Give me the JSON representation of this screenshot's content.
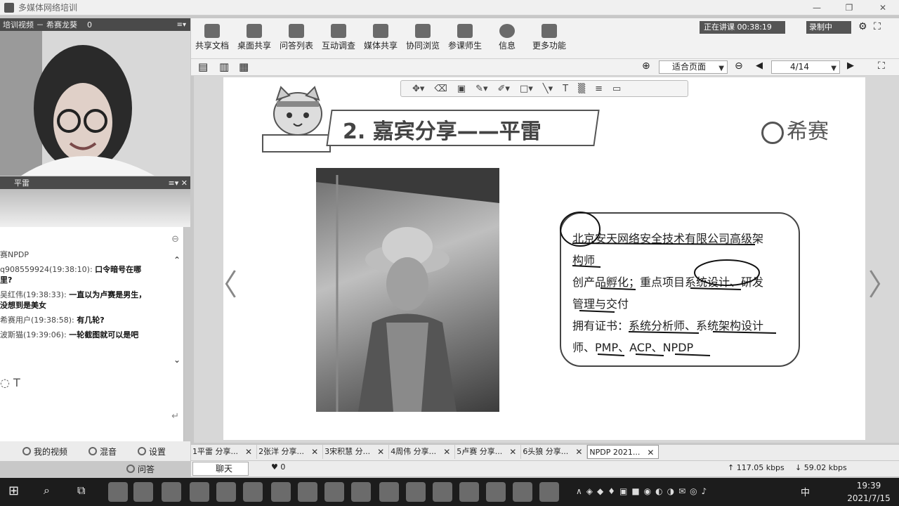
{
  "window": {
    "title": "多媒体网络培训"
  },
  "video_panel": {
    "title": "培训视频 － 希赛龙葵",
    "count": "0"
  },
  "participant_panel": {
    "name": "平雷"
  },
  "chat": {
    "lines": [
      {
        "who": "赛NPDP",
        "msg": ""
      },
      {
        "who": "q908559924(19:38:10):",
        "msg": "口令暗号在哪"
      },
      {
        "who": "",
        "msg": "里?"
      },
      {
        "who": "吴红伟(19:38:33):",
        "msg": "一直以为卢赛是男生，"
      },
      {
        "who": "",
        "msg": "没想到是美女"
      },
      {
        "who": "希赛用户(19:38:58):",
        "msg": "有几轮?"
      },
      {
        "who": "波斯猫(19:39:06):",
        "msg": "一轮截图就可以是吧"
      }
    ]
  },
  "left_bottom": {
    "my_video": "我的视频",
    "mix": "混音",
    "settings": "设置",
    "qa": "问答"
  },
  "toolbar": {
    "buttons": [
      "共享文档",
      "桌面共享",
      "问答列表",
      "互动调查",
      "媒体共享",
      "协同浏览",
      "参课师生",
      "信息",
      "更多功能"
    ],
    "status_left": "正在讲课 00:38:19",
    "status_right": "录制中"
  },
  "nav": {
    "zoom": "适合页面",
    "page": "4/14"
  },
  "slide": {
    "title": "2. 嘉宾分享——平雷",
    "brand": "希赛",
    "info_lines": [
      "北京安天网络安全技术有限公司高级架",
      "构师",
      "创产品孵化；重点项目系统设计、研发",
      "管理与交付",
      "拥有证书：系统分析师、系统架构设计",
      "师、PMP、ACP、NPDP"
    ]
  },
  "page_tabs": [
    "1平雷 分享...",
    "2张洋 分享...",
    "3宋积慧 分...",
    "4周伟 分享...",
    "5卢赛 分享...",
    "6头狼 分享...",
    "NPDP 2021..."
  ],
  "status": {
    "chat_tab": "聊天",
    "likes": "0",
    "up": "117.05 kbps",
    "down": "59.02 kbps"
  },
  "taskbar": {
    "ime": "中",
    "time": "19:39",
    "date": "2021/7/15"
  }
}
